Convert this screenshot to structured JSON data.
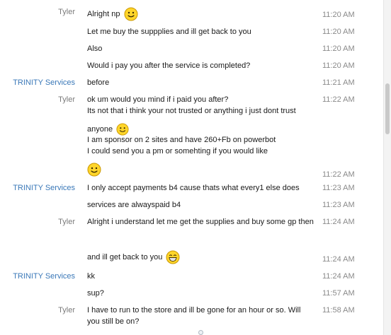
{
  "conversation": {
    "messages": [
      {
        "sender": "Tyler",
        "sender_type": "tyler",
        "lines": [
          "Alright np"
        ],
        "time": "11:20 AM",
        "emoji": "smile-emoji-icon"
      },
      {
        "sender": "",
        "sender_type": "tyler",
        "lines": [
          "Let me buy the suppplies and ill get back to you"
        ],
        "time": "11:20 AM"
      },
      {
        "sender": "",
        "sender_type": "tyler",
        "lines": [
          "Also"
        ],
        "time": "11:20 AM"
      },
      {
        "sender": "",
        "sender_type": "tyler",
        "lines": [
          "Would i pay you after the service is completed?"
        ],
        "time": "11:20 AM"
      },
      {
        "sender": "TRINITY Services",
        "sender_type": "trinity",
        "lines": [
          "before"
        ],
        "time": "11:21 AM"
      },
      {
        "sender": "Tyler",
        "sender_type": "tyler",
        "lines": [
          "ok um would you mind if i paid you after?",
          "Its not that i think your not trusted or anything i just dont trust",
          "anyone"
        ],
        "time": "11:22 AM",
        "emoji": "smile-emoji-icon"
      },
      {
        "sender": "",
        "sender_type": "tyler",
        "lines": [
          "I am sponsor on 2 sites and have 260+Fb on powerbot",
          "I could send you a pm or somehting if you would like"
        ],
        "time": ""
      },
      {
        "sender": "",
        "sender_type": "tyler",
        "lines": [],
        "time": "11:22 AM",
        "emoji": "smile-emoji-icon"
      },
      {
        "sender": "TRINITY Services",
        "sender_type": "trinity",
        "lines": [
          "I only accept payments b4 cause thats what every1 else does"
        ],
        "time": "11:23 AM"
      },
      {
        "sender": "",
        "sender_type": "trinity",
        "lines": [
          "services are alwayspaid b4"
        ],
        "time": "11:23 AM"
      },
      {
        "sender": "Tyler",
        "sender_type": "tyler",
        "lines": [
          "Alright i understand let me get the supplies and buy some gp then"
        ],
        "time": "11:24 AM"
      },
      {
        "sender": "",
        "sender_type": "tyler",
        "lines": [
          "and ill get back to you"
        ],
        "time": "11:24 AM",
        "emoji": "grin-emoji-icon"
      },
      {
        "sender": "TRINITY Services",
        "sender_type": "trinity",
        "lines": [
          "kk"
        ],
        "time": "11:24 AM"
      },
      {
        "sender": "",
        "sender_type": "trinity",
        "lines": [
          "sup?"
        ],
        "time": "11:57 AM"
      },
      {
        "sender": "Tyler",
        "sender_type": "tyler",
        "lines": [
          "I have to run to the store and ill be gone for an hour or so. Will",
          "you still be on?"
        ],
        "time": "11:58 AM"
      }
    ]
  },
  "colors": {
    "sender_tyler": "#7a7a7a",
    "sender_trinity": "#3a78b8",
    "timestamp": "#8a8a8a",
    "emoji_fill": "#ffd52a",
    "emoji_stroke": "#c99700"
  }
}
